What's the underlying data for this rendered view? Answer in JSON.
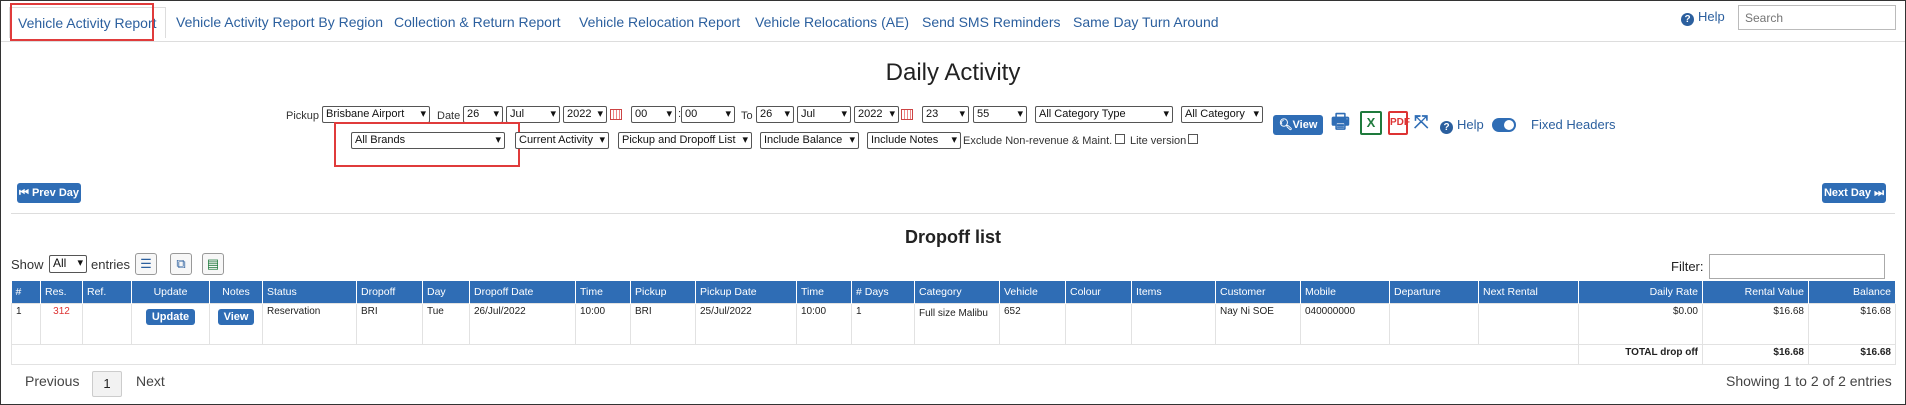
{
  "nav": {
    "tabs": [
      {
        "label": "Vehicle Activity Report"
      },
      {
        "label": "Vehicle Activity Report By Region"
      },
      {
        "label": "Collection & Return Report"
      },
      {
        "label": "Vehicle Relocation Report"
      },
      {
        "label": "Vehicle Relocations (AE)"
      },
      {
        "label": "Send SMS Reminders"
      },
      {
        "label": "Same Day Turn Around"
      }
    ],
    "help": "Help",
    "search_placeholder": "Search"
  },
  "page_title": "Daily Activity",
  "filters": {
    "pickup_label": "Pickup",
    "pickup_location": "Brisbane Airport",
    "date_label": "Date",
    "from_day": "26",
    "from_month": "Jul",
    "from_year": "2022",
    "from_hour": "00",
    "from_min": "00",
    "to_label": "To",
    "to_day": "26",
    "to_month": "Jul",
    "to_year": "2022",
    "to_hour": "23",
    "to_min": "55",
    "category_type": "All Category Type",
    "category": "All Category",
    "brands": "All Brands",
    "activity": "Current Activity",
    "list_type": "Pickup and Dropoff List",
    "balance": "Include Balance",
    "notes": "Include Notes",
    "exclude_label": "Exclude Non-revenue & Maint.",
    "lite_label": "Lite version"
  },
  "toolbar": {
    "view": "View",
    "help": "Help",
    "fixed_headers": "Fixed Headers",
    "prev_day": "Prev Day",
    "next_day": "Next Day"
  },
  "dropoff": {
    "title": "Dropoff list",
    "show_label": "Show",
    "show_value": "All",
    "entries_label": "entries",
    "filter_label": "Filter:",
    "columns": [
      "#",
      "Res.",
      "Ref.",
      "Update",
      "Notes",
      "Status",
      "Dropoff",
      "Day",
      "Dropoff Date",
      "Time",
      "Pickup",
      "Pickup Date",
      "Time",
      "# Days",
      "Category",
      "Vehicle",
      "Colour",
      "Items",
      "Customer",
      "Mobile",
      "Departure",
      "Next Rental",
      "Daily Rate",
      "Rental Value",
      "Balance"
    ],
    "row": {
      "num": "1",
      "res": "312",
      "ref": "",
      "update": "Update",
      "notes": "View",
      "status": "Reservation",
      "dropoff": "BRI",
      "day": "Tue",
      "dropoff_date": "26/Jul/2022",
      "time": "10:00",
      "pickup": "BRI",
      "pickup_date": "25/Jul/2022",
      "pickup_time": "10:00",
      "days": "1",
      "category": "Full size Malibu",
      "vehicle": "652",
      "colour": "",
      "items": "",
      "customer": "Nay Ni SOE",
      "mobile": "040000000",
      "departure": "",
      "next_rental": "",
      "daily_rate": "$0.00",
      "rental_value": "$16.68",
      "balance": "$16.68"
    },
    "total": {
      "label": "TOTAL drop off",
      "rental_value": "$16.68",
      "balance": "$16.68"
    },
    "pagination": {
      "previous": "Previous",
      "page": "1",
      "next": "Next",
      "showing": "Showing 1 to 2 of 2 entries"
    }
  },
  "colors": {
    "accent": "#2f6db5",
    "link": "#2b5f9e",
    "highlight": "#e03b3b"
  }
}
